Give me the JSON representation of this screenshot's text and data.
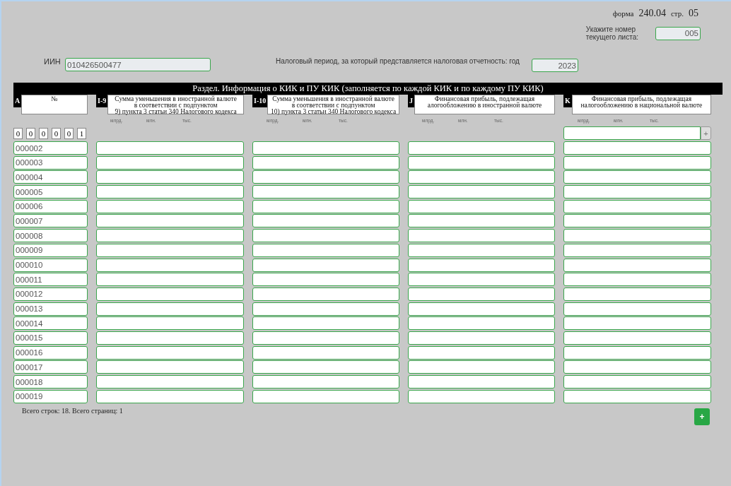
{
  "form": {
    "label": "форма",
    "number": "240.04",
    "page_label": "стр.",
    "page": "05"
  },
  "sheet": {
    "label": "Укажите номер\nтекущего листа:",
    "value": "005"
  },
  "iin": {
    "label": "ИИН",
    "value": "010426500477"
  },
  "period": {
    "label": "Налоговый период, за который представляется налоговая отчетность: год",
    "value": "2023"
  },
  "section_title": "Раздел. Информация о КИК и ПУ КИК (заполняется по каждой КИК и по каждому ПУ КИК)",
  "columns": [
    {
      "letter": "A",
      "title": "№"
    },
    {
      "letter": "I-9",
      "title": "Сумма уменьшения в иностранной валюте\nв соответствии с подпунктом\n9) пункта 3 статьи 340 Налогового кодекса",
      "units": [
        "млрд.",
        "млн.",
        "тыс."
      ]
    },
    {
      "letter": "I-10",
      "title": "Сумма уменьшения в иностранной валюте\nв соответствии с подпунктом\n10) пункта 3 статьи 340 Налогового кодекса",
      "units": [
        "млрд.",
        "млн.",
        "тыс."
      ]
    },
    {
      "letter": "J",
      "title": "Финансовая прибыль, подлежащая\nалогообложению в иностранной валюте",
      "units": [
        "млрд.",
        "млн.",
        "тыс."
      ]
    },
    {
      "letter": "K",
      "title": "Финансовая прибыль, подлежащая\nналогообложению в национальной валюте",
      "units": [
        "млрд.",
        "млн.",
        "тыс."
      ]
    }
  ],
  "first_row": {
    "digits": [
      "0",
      "0",
      "0",
      "0",
      "0",
      "1"
    ],
    "k_button": "+"
  },
  "rows": [
    "000002",
    "000003",
    "000004",
    "000005",
    "000006",
    "000007",
    "000008",
    "000009",
    "000010",
    "000011",
    "000012",
    "000013",
    "000014",
    "000015",
    "000016",
    "000017",
    "000018",
    "000019"
  ],
  "footer": "Всего строк: 18. Всего страниц: 1",
  "add_button": "+"
}
